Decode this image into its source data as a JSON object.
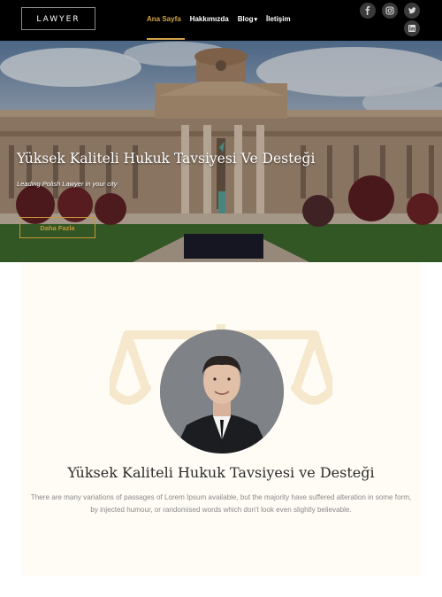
{
  "header": {
    "logo": "LAWYER",
    "nav": [
      {
        "label": "Ana Sayfa",
        "active": true
      },
      {
        "label": "Hakkımızda"
      },
      {
        "label": "Blog",
        "dropdown": true
      },
      {
        "label": "İletişim"
      }
    ],
    "social": [
      "facebook-icon",
      "instagram-icon",
      "twitter-icon",
      "linkedin-icon"
    ]
  },
  "hero": {
    "title": "Yüksek Kaliteli Hukuk Tavsiyesi Ve Desteği",
    "subtitle": "Leading Polish Lawyer in your city",
    "button": "Daha Fazla"
  },
  "about": {
    "title": "Yüksek Kaliteli Hukuk Tavsiyesi ve Desteği",
    "text": "There are many variations of passages of Lorem Ipsum available, but the majority have suffered alteration in some form, by injected humour, or randomised words which don't look even slightly believable."
  },
  "colors": {
    "accent": "#d4a24a",
    "nav_bg": "#000000",
    "section_bg": "#fffcf5"
  }
}
